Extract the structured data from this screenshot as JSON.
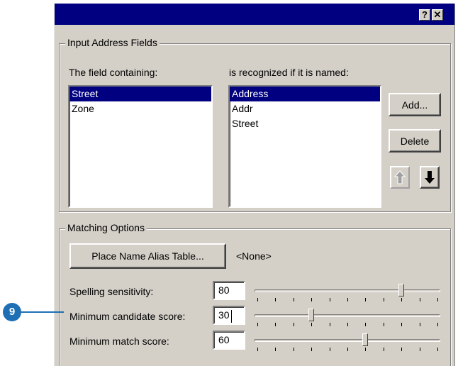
{
  "titlebar": {
    "help_label": "?",
    "close_label": "✕"
  },
  "input_fields": {
    "legend": "Input Address Fields",
    "left_header": "The field containing:",
    "right_header": "is recognized if it is named:",
    "fields": [
      {
        "label": "Street",
        "selected": true
      },
      {
        "label": "Zone",
        "selected": false
      }
    ],
    "aliases": [
      {
        "label": "Address",
        "selected": true
      },
      {
        "label": "Addr",
        "selected": false
      },
      {
        "label": "Street",
        "selected": false
      }
    ],
    "add_label": "Add...",
    "delete_label": "Delete",
    "move_up_icon": "up-arrow-icon",
    "move_down_icon": "down-arrow-icon"
  },
  "matching": {
    "legend": "Matching Options",
    "alias_button_label": "Place Name Alias Table...",
    "alias_value": "<None>",
    "spelling_label": "Spelling sensitivity:",
    "spelling_value": "80",
    "candidate_label": "Minimum candidate score:",
    "candidate_value": "30",
    "match_label": "Minimum match score:",
    "match_value": "60"
  },
  "callout": {
    "number": "9"
  },
  "colors": {
    "selection": "#000080",
    "dialog_bg": "#d4d0c8",
    "callout": "#1e6fb4"
  }
}
